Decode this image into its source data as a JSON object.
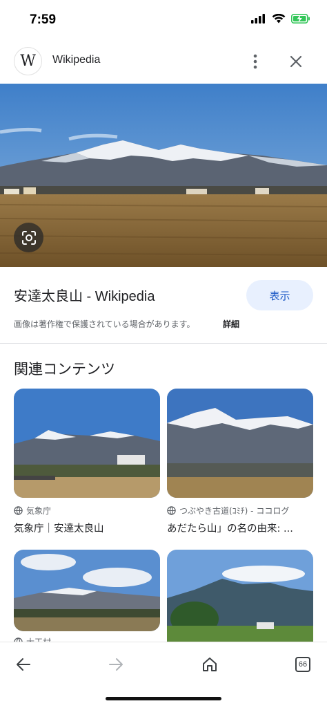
{
  "status_bar": {
    "time": "7:59"
  },
  "header": {
    "site_name": "Wikipedia",
    "logo_letter": "W"
  },
  "result": {
    "title": "安達太良山 - Wikipedia",
    "view_label": "表示",
    "notice": "画像は著作権で保護されている場合があります。",
    "details_label": "詳細"
  },
  "related": {
    "heading": "関連コンテンツ",
    "items": [
      {
        "source": "気象庁",
        "caption": "気象庁｜安達太良山"
      },
      {
        "source": "つぶやき古道(ｺﾐﾁ) - ココログ",
        "caption": "あだたら山」の名の由来: ..."
      },
      {
        "source": "大玉村",
        "caption": ""
      },
      {
        "source": "",
        "caption": ""
      }
    ]
  },
  "bottom_nav": {
    "tab_count": "66"
  },
  "colors": {
    "accent": "#1a57c5",
    "view_button_bg": "#e8f0fe",
    "sky": "#4a88cf",
    "field": "#8a6a3a"
  }
}
